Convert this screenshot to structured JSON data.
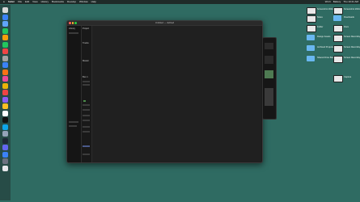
{
  "menubar": {
    "app": "Safari",
    "items": [
      "File",
      "Edit",
      "View",
      "History",
      "Bookmarks",
      "Develop",
      "Window",
      "Help"
    ],
    "status": [
      "Wi-Fi",
      "Battery",
      "Thu 10:41 AM"
    ]
  },
  "window": {
    "title": "Untitled — Edited",
    "sidebar_label": "Library",
    "inner_labels": [
      "Project",
      "Tracks",
      "Master",
      "Bus 1"
    ]
  },
  "dock_colors": [
    "#d9d9d9",
    "#3b82f6",
    "#60a5fa",
    "#22c55e",
    "#f59e0b",
    "#22c55e",
    "#ef4444",
    "#a3a3a3",
    "#3b82f6",
    "#f97316",
    "#ec4899",
    "#eab308",
    "#ef4444",
    "#8b5cf6",
    "#fbbf24",
    "#ffffff",
    "#111111",
    "#0ea5e9",
    "#94a3b8",
    "#1f2937",
    "#6366f1",
    "#3b82f6",
    "#6b7280",
    "#e5e7eb"
  ],
  "desktop": {
    "left_col": [
      {
        "label": "Screenshot 2024-03-...",
        "icon": "screenshot-icon"
      },
      {
        "label": "Notes",
        "icon": "screenshot-icon"
      },
      {
        "label": "Folder",
        "icon": "screenshot-icon"
      },
      {
        "label": "Design Assets",
        "icon": "folder-icon"
      },
      {
        "label": "Archived Projects",
        "icon": "folder-icon"
      },
      {
        "label": "Shared Drive Backup",
        "icon": "folder-icon"
      }
    ],
    "right_col": [
      {
        "label": "Screenshot 2024-...",
        "icon": "screenshot-icon"
      },
      {
        "label": "Downloads",
        "icon": "folder-icon"
      },
      {
        "label": "Docs",
        "icon": "screenshot-icon"
      },
      {
        "label": "Screen Recording 2024",
        "icon": "screenshot-icon"
      },
      {
        "label": "Screen Recording 2024 (2)",
        "icon": "screenshot-icon"
      },
      {
        "label": "Screen Recording 2024 (3)",
        "icon": "screenshot-icon"
      },
      {
        "label": "Capture",
        "icon": "screenshot-icon"
      }
    ]
  }
}
